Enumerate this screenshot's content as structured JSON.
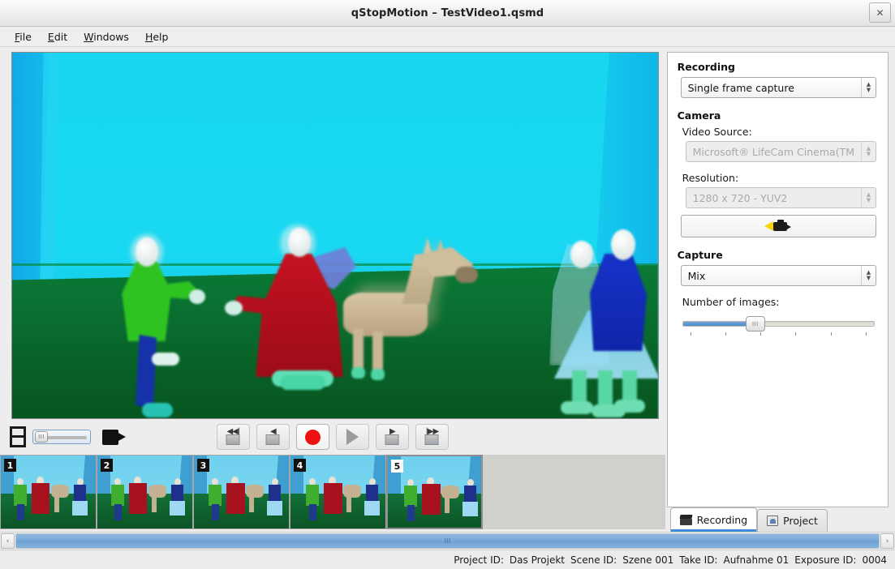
{
  "window": {
    "title": "qStopMotion – TestVideo1.qsmd",
    "close_label": "✕"
  },
  "menu": {
    "items": [
      {
        "name": "file",
        "mnemonic": "F",
        "rest": "ile"
      },
      {
        "name": "edit",
        "mnemonic": "E",
        "rest": "dit"
      },
      {
        "name": "windows",
        "mnemonic": "W",
        "rest": "indows"
      },
      {
        "name": "help",
        "mnemonic": "H",
        "rest": "elp"
      }
    ]
  },
  "transport": {
    "mini_slider_knob": "III",
    "buttons": [
      {
        "name": "skip-to-first-frame-button",
        "icon": "skip-backward-icon",
        "glyph": "◀◀|"
      },
      {
        "name": "previous-frame-button",
        "icon": "step-backward-icon",
        "glyph": "◀"
      },
      {
        "name": "record-button",
        "icon": "record-icon",
        "glyph": ""
      },
      {
        "name": "play-button",
        "icon": "play-icon",
        "glyph": ""
      },
      {
        "name": "next-frame-button",
        "icon": "step-forward-icon",
        "glyph": "▶"
      },
      {
        "name": "skip-to-last-frame-button",
        "icon": "skip-forward-icon",
        "glyph": "|▶▶"
      }
    ]
  },
  "filmstrip": {
    "frames": [
      {
        "number": "1",
        "selected": false
      },
      {
        "number": "2",
        "selected": false
      },
      {
        "number": "3",
        "selected": false
      },
      {
        "number": "4",
        "selected": false
      },
      {
        "number": "5",
        "selected": true
      }
    ],
    "scroll_left_arrow": "‹",
    "scroll_right_arrow": "›",
    "scroll_thumb_grip": "III"
  },
  "panel": {
    "recording": {
      "group_label": "Recording",
      "mode_value": "Single frame capture"
    },
    "camera": {
      "group_label": "Camera",
      "video_source_label": "Video Source:",
      "video_source_value": "Microsoft® LifeCam Cinema(TM",
      "resolution_label": "Resolution:",
      "resolution_value": "1280 x 720 - YUV2",
      "test_button_icon": "video-camera-icon"
    },
    "capture": {
      "group_label": "Capture",
      "mode_value": "Mix",
      "number_of_images_label": "Number of images:",
      "slider_knob_grip": "III",
      "slider_percent": 38,
      "slider_tick_count": 6
    },
    "tabs": [
      {
        "label": "Recording",
        "icon": "clapperboard-icon",
        "active": true
      },
      {
        "label": "Project",
        "icon": "project-icon",
        "active": false
      }
    ]
  },
  "statusbar": {
    "project_id_label": "Project ID:",
    "project_id_value": "Das Projekt",
    "scene_id_label": "Scene ID:",
    "scene_id_value": "Szene 001",
    "take_id_label": "Take ID:",
    "take_id_value": "Aufnahme 01",
    "exposure_id_label": "Exposure ID:",
    "exposure_id_value": "0004"
  },
  "colors": {
    "accent": "#3c8fd8",
    "record": "#ee1111",
    "scrollbar": "#7aa9d8",
    "backdrop": "#18d6ef",
    "floor": "#0a6f31"
  }
}
